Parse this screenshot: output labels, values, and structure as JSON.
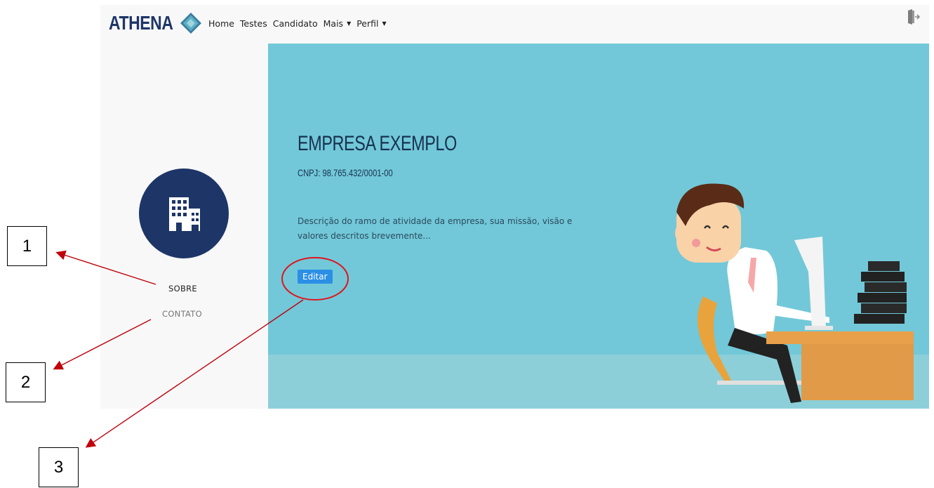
{
  "navbar": {
    "brand": "ATHENA",
    "links": [
      {
        "label": "Home",
        "dropdown": false
      },
      {
        "label": "Testes",
        "dropdown": false
      },
      {
        "label": "Candidato",
        "dropdown": false
      },
      {
        "label": "Mais",
        "dropdown": true
      },
      {
        "label": "Perfil",
        "dropdown": true
      }
    ],
    "logout_icon": "logout-door-icon"
  },
  "sidebar": {
    "avatar_icon": "building-icon",
    "items": [
      {
        "label": "SOBRE"
      },
      {
        "label": "CONTATO"
      }
    ]
  },
  "hero": {
    "title": "EMPRESA EXEMPLO",
    "cnpj": "CNPJ: 98.765.432/0001-00",
    "description": "Descrição do ramo de atividade da empresa, sua missão, visão e valores descritos brevemente...",
    "edit_label": "Editar"
  },
  "annotations": {
    "callouts": [
      {
        "label": "1"
      },
      {
        "label": "2"
      },
      {
        "label": "3"
      }
    ],
    "arrow_color": "#c0000b",
    "circle_color": "#e0141e"
  },
  "colors": {
    "brand_navy": "#1e3567",
    "hero_bg": "#72c8d8",
    "button_blue": "#2b8fe6"
  }
}
